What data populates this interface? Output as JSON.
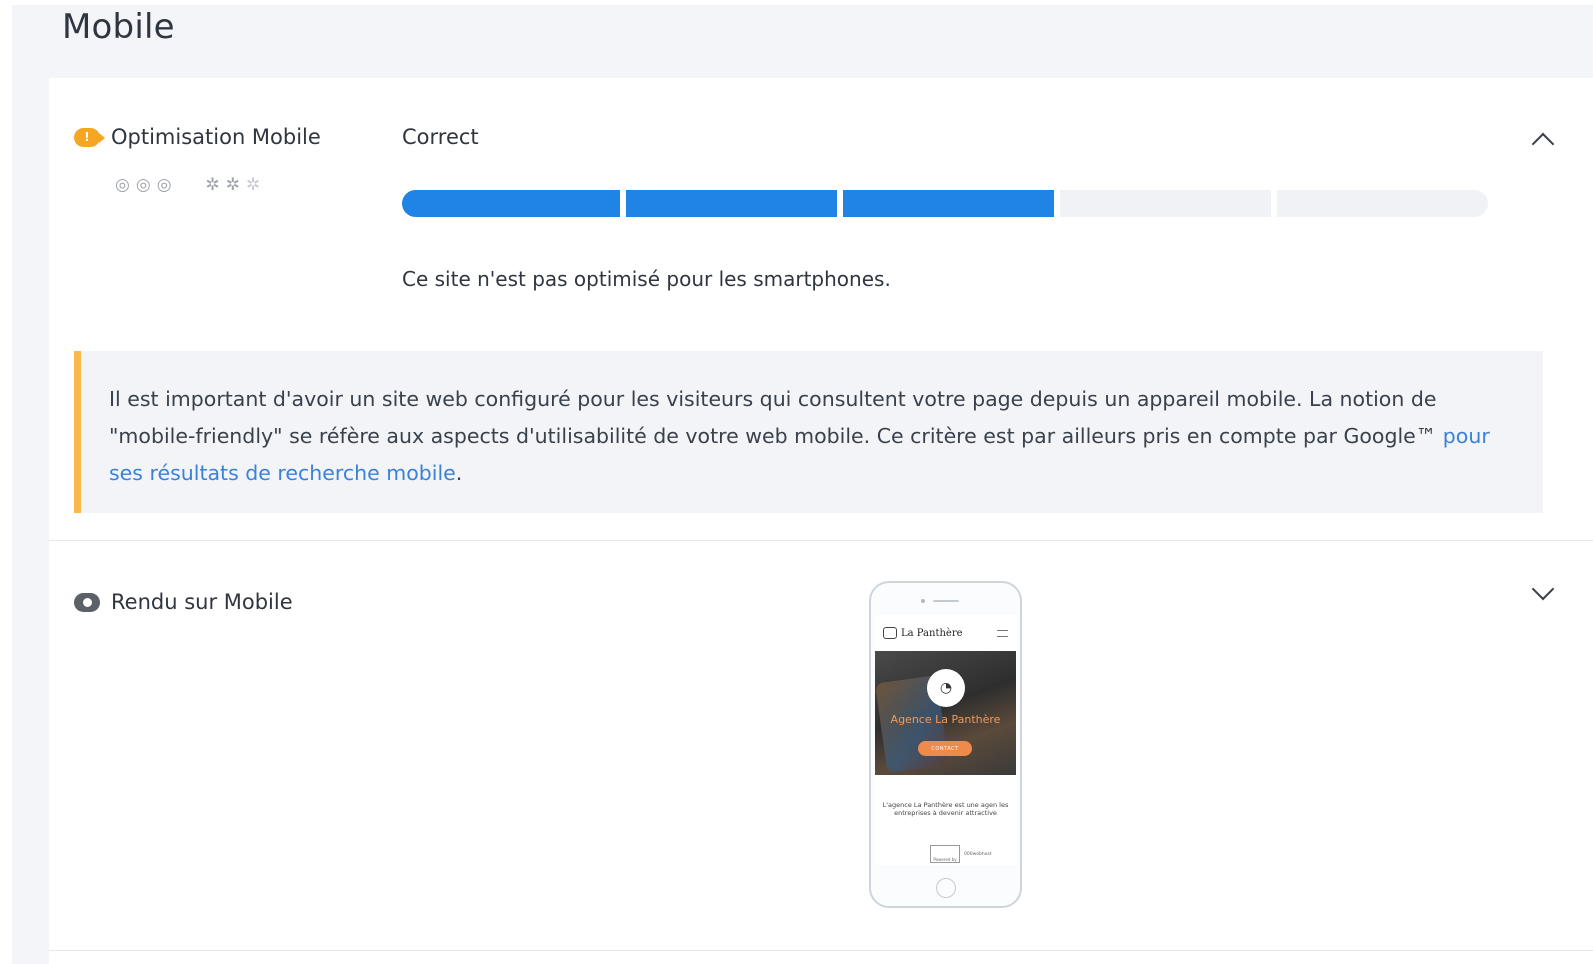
{
  "page": {
    "title": "Mobile"
  },
  "optimisation": {
    "label": "Optimisation Mobile",
    "status_icon": "warning-icon",
    "status_color": "#f5a623",
    "rating_icons": [
      "target-icon",
      "target-icon",
      "target-icon",
      "gear-icon",
      "gear-icon",
      "gear-icon"
    ],
    "status_word": "Correct",
    "score_segments_total": 5,
    "score_segments_filled": 3,
    "bar_color": "#1f84e6",
    "sentence": "Ce site n'est pas optimisé pour les smartphones.",
    "callout": {
      "text": "Il est important d'avoir un site web configuré pour les visiteurs qui consultent votre page depuis un appareil mobile. La notion de \"mobile-friendly\" se réfère aux aspects d'utilisabilité de votre web mobile. Ce critère est par ailleurs pris en compte par Google™ ",
      "link": "pour ses résultats de recherche mobile",
      "end": "."
    },
    "toggle_icon": "chevron-up-icon"
  },
  "rendu": {
    "label": "Rendu sur Mobile",
    "icon": "eye-icon",
    "toggle_icon": "chevron-down-icon",
    "preview": {
      "site_name": "La Panthère",
      "hero_title": "Agence La Panthère",
      "cta": "CONTACT",
      "body_text": "L'agence La Panthère est une agen les entreprises à devenir attractive",
      "footer": "Powered by",
      "footer_brand": "000webhost"
    }
  }
}
